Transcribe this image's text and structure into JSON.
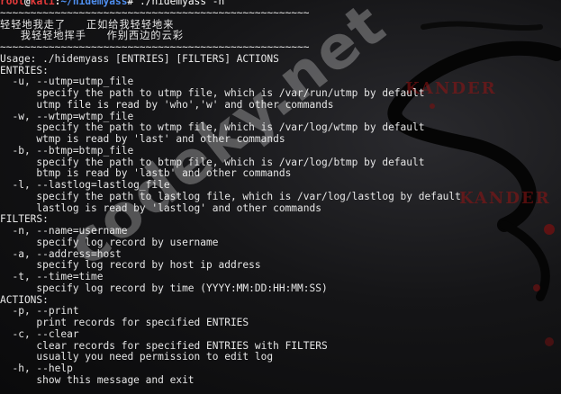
{
  "prompt": {
    "user": "root",
    "host": "kali",
    "path": "~/hidemyass",
    "command": "./hidemyass -h"
  },
  "output": [
    "~~~~~~~~~~~~~~~~~~~~~~~~~~~~~~~~~~~~~~~~~~~~~~~~~~~",
    "轻轻地我走了     正如给我轻轻地来",
    "     我轻轻地挥手     作别西边的云彩",
    "~~~~~~~~~~~~~~~~~~~~~~~~~~~~~~~~~~~~~~~~~~~~~~~~~~~",
    "Usage: ./hidemyass [ENTRIES] [FILTERS] ACTIONS",
    "ENTRIES:",
    "  -u, --utmp=utmp_file",
    "      specify the path to utmp file, which is /var/run/utmp by default",
    "      utmp file is read by 'who','w' and other commands",
    "  -w, --wtmp=wtmp_file",
    "      specify the path to wtmp file, which is /var/log/wtmp by default",
    "      wtmp is read by 'last' and other commands",
    "  -b, --btmp=btmp_file",
    "      specify the path to btmp file, which is /var/log/btmp by default",
    "      btmp is read by 'lastb' and other commands",
    "  -l, --lastlog=lastlog_file",
    "      specify the path to lastlog file, which is /var/log/lastlog by default",
    "      lastlog is read by 'lastlog' and other commands",
    "FILTERS:",
    "  -n, --name=username",
    "      specify log record by username",
    "  -a, --address=host",
    "      specify log record by host ip address",
    "  -t, --time=time",
    "      specify log record by time (YYYY:MM:DD:HH:MM:SS)",
    "ACTIONS:",
    "  -p, --print",
    "      print records for specified ENTRIES",
    "  -c, --clear",
    "      clear records for specified ENTRIES with FILTERS",
    "      usually you need permission to edit log",
    "  -h, --help",
    "      show this message and exit"
  ],
  "watermark": "codeky.net",
  "background_logo_text": "KANDER",
  "colors": {
    "background": "#0b0b0c",
    "text": "#e6e6e6",
    "prompt_user": "#e63b3b",
    "prompt_path": "#4f8ff0",
    "logo": "#961414"
  }
}
